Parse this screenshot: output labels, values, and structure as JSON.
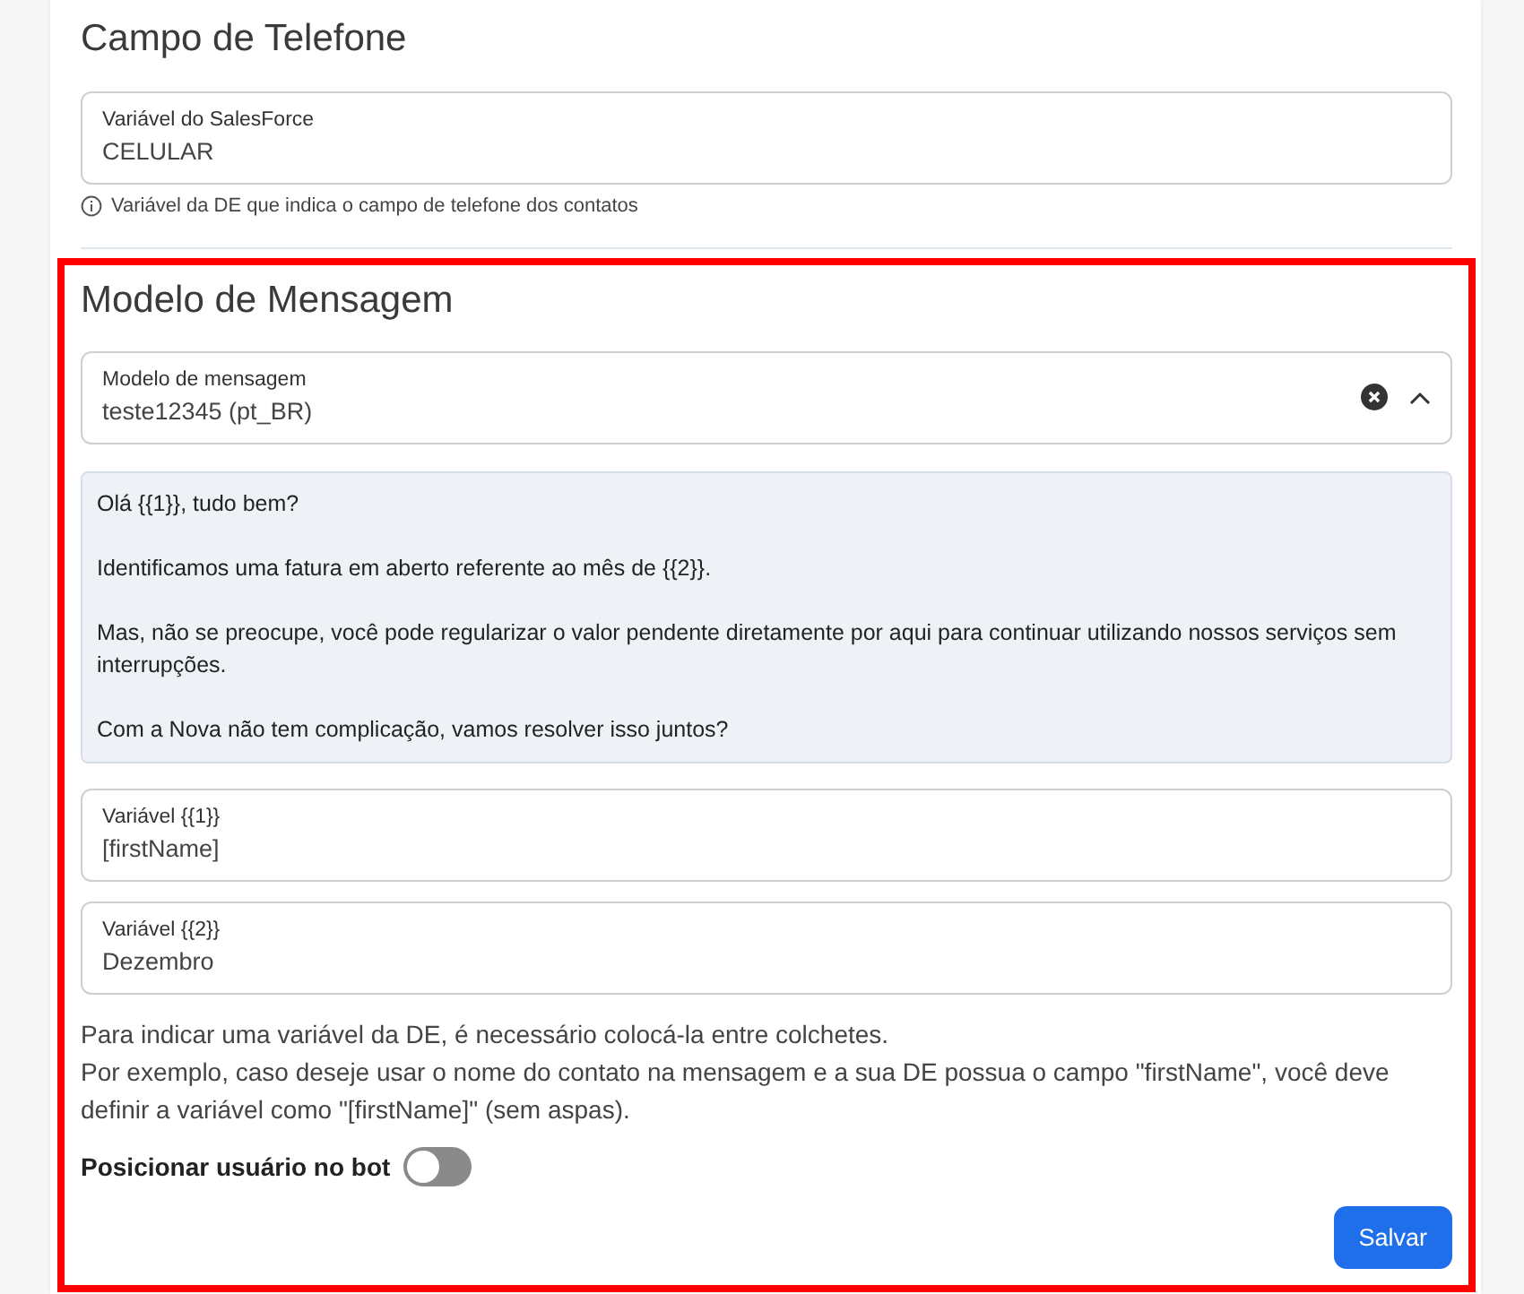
{
  "phone_section": {
    "title": "Campo de Telefone",
    "field": {
      "label": "Variável do SalesForce",
      "value": "CELULAR"
    },
    "hint": "Variável da DE que indica o campo de telefone dos contatos"
  },
  "message_section": {
    "highlighted": true,
    "title": "Modelo de Mensagem",
    "template_select": {
      "label": "Modelo de mensagem",
      "value": "teste12345 (pt_BR)",
      "expanded": true
    },
    "preview": [
      "Olá {{1}}, tudo bem?",
      "Identificamos uma fatura em aberto referente ao mês de {{2}}.",
      "Mas, não se preocupe, você pode regularizar o valor pendente diretamente por aqui para continuar utilizando nossos serviços sem interrupções.",
      "Com a Nova não tem complicação, vamos resolver isso juntos?"
    ],
    "variables": [
      {
        "label": "Variável {{1}}",
        "value": "[firstName]"
      },
      {
        "label": "Variável {{2}}",
        "value": "Dezembro"
      }
    ],
    "help": [
      "Para indicar uma variável da DE, é necessário colocá-la entre colchetes.",
      "Por exemplo, caso deseje usar o nome do contato na mensagem e a sua DE possua o campo \"firstName\", você deve definir a variável como \"[firstName]\" (sem aspas)."
    ],
    "toggle": {
      "label": "Posicionar usuário no bot",
      "on": false
    },
    "save_button": "Salvar"
  }
}
